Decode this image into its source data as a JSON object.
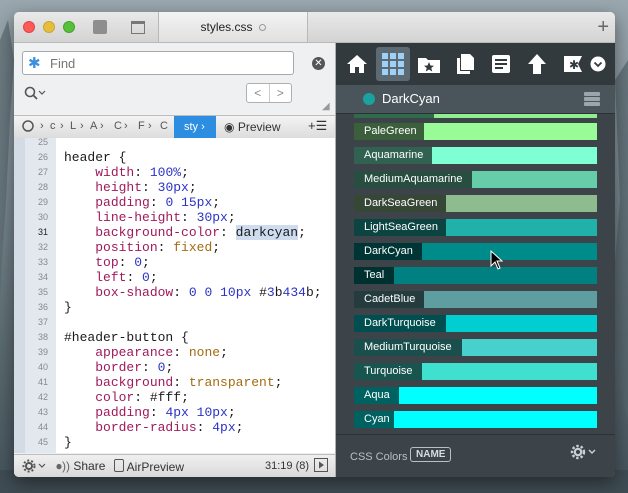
{
  "window": {
    "tab_title": "styles.css"
  },
  "find": {
    "placeholder": "Find"
  },
  "breadcrumb": {
    "items": [
      "c",
      "L",
      "A",
      "C",
      "F",
      "C"
    ],
    "active": "sty",
    "preview_label": "Preview"
  },
  "editor": {
    "current_line": "31",
    "lines": [
      {
        "n": "25",
        "t": ""
      },
      {
        "n": "26",
        "t": "header {"
      },
      {
        "n": "27",
        "t": "    width: 100%;"
      },
      {
        "n": "28",
        "t": "    height: 30px;"
      },
      {
        "n": "29",
        "t": "    padding: 0 15px;"
      },
      {
        "n": "30",
        "t": "    line-height: 30px;"
      },
      {
        "n": "31",
        "t": "    background-color: darkcyan;"
      },
      {
        "n": "32",
        "t": "    position: fixed;"
      },
      {
        "n": "33",
        "t": "    top: 0;"
      },
      {
        "n": "34",
        "t": "    left: 0;"
      },
      {
        "n": "35",
        "t": "    box-shadow: 0 0 10px #3b434b;"
      },
      {
        "n": "36",
        "t": "}"
      },
      {
        "n": "37",
        "t": ""
      },
      {
        "n": "38",
        "t": "#header-button {"
      },
      {
        "n": "39",
        "t": "    appearance: none;"
      },
      {
        "n": "40",
        "t": "    border: 0;"
      },
      {
        "n": "41",
        "t": "    background: transparent;"
      },
      {
        "n": "42",
        "t": "    color: #fff;"
      },
      {
        "n": "43",
        "t": "    padding: 4px 10px;"
      },
      {
        "n": "44",
        "t": "    border-radius: 4px;"
      },
      {
        "n": "45",
        "t": "}"
      }
    ]
  },
  "statusbar": {
    "share_label": "Share",
    "airpreview_label": "AirPreview",
    "position": "31:19 (8)"
  },
  "panel": {
    "title": "DarkCyan",
    "footer_label": "CSS Colors",
    "footer_badge": "NAME"
  },
  "colors": [
    {
      "name": "PaleGreen",
      "hex": "#98fb98",
      "label_width": 70
    },
    {
      "name": "Aquamarine",
      "hex": "#7fffd4",
      "label_width": 78
    },
    {
      "name": "MediumAquamarine",
      "hex": "#66cdaa",
      "label_width": 118
    },
    {
      "name": "DarkSeaGreen",
      "hex": "#8fbc8f",
      "label_width": 92
    },
    {
      "name": "LightSeaGreen",
      "hex": "#20b2aa",
      "label_width": 92
    },
    {
      "name": "DarkCyan",
      "hex": "#008b8b",
      "label_width": 68
    },
    {
      "name": "Teal",
      "hex": "#008080",
      "label_width": 40
    },
    {
      "name": "CadetBlue",
      "hex": "#5f9ea0",
      "label_width": 70
    },
    {
      "name": "DarkTurquoise",
      "hex": "#00ced1",
      "label_width": 92
    },
    {
      "name": "MediumTurquoise",
      "hex": "#48d1cc",
      "label_width": 108
    },
    {
      "name": "Turquoise",
      "hex": "#40e0d0",
      "label_width": 68
    },
    {
      "name": "Aqua",
      "hex": "#00ffff",
      "label_width": 45
    },
    {
      "name": "Cyan",
      "hex": "#00ffff",
      "label_width": 40
    }
  ]
}
